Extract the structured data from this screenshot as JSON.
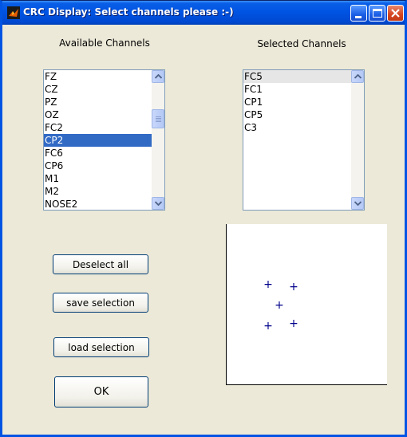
{
  "window": {
    "title": "CRC Display: Select channels please :-)"
  },
  "titlebar_buttons": {
    "minimize_icon": "minimize-icon",
    "maximize_icon": "maximize-icon",
    "close_icon": "close-icon"
  },
  "available": {
    "label": "Available Channels",
    "items": [
      "FZ",
      "CZ",
      "PZ",
      "OZ",
      "FC2",
      "CP2",
      "FC6",
      "CP6",
      "M1",
      "M2",
      "NOSE2"
    ],
    "selected_item": "CP2"
  },
  "selected": {
    "label": "Selected Channels",
    "items": [
      "FC5",
      "FC1",
      "CP1",
      "CP5",
      "C3"
    ],
    "focused_item": "FC5"
  },
  "buttons": {
    "deselect_all": "Deselect all",
    "save_selection": "save selection",
    "load_selection": "load selection",
    "ok": "OK"
  },
  "plot": {
    "marker": "+",
    "marker_color": "#00008b"
  },
  "colors": {
    "selection_highlight": "#316ac5",
    "titlebar": "#0054e3",
    "window_bg": "#ece9d8"
  }
}
